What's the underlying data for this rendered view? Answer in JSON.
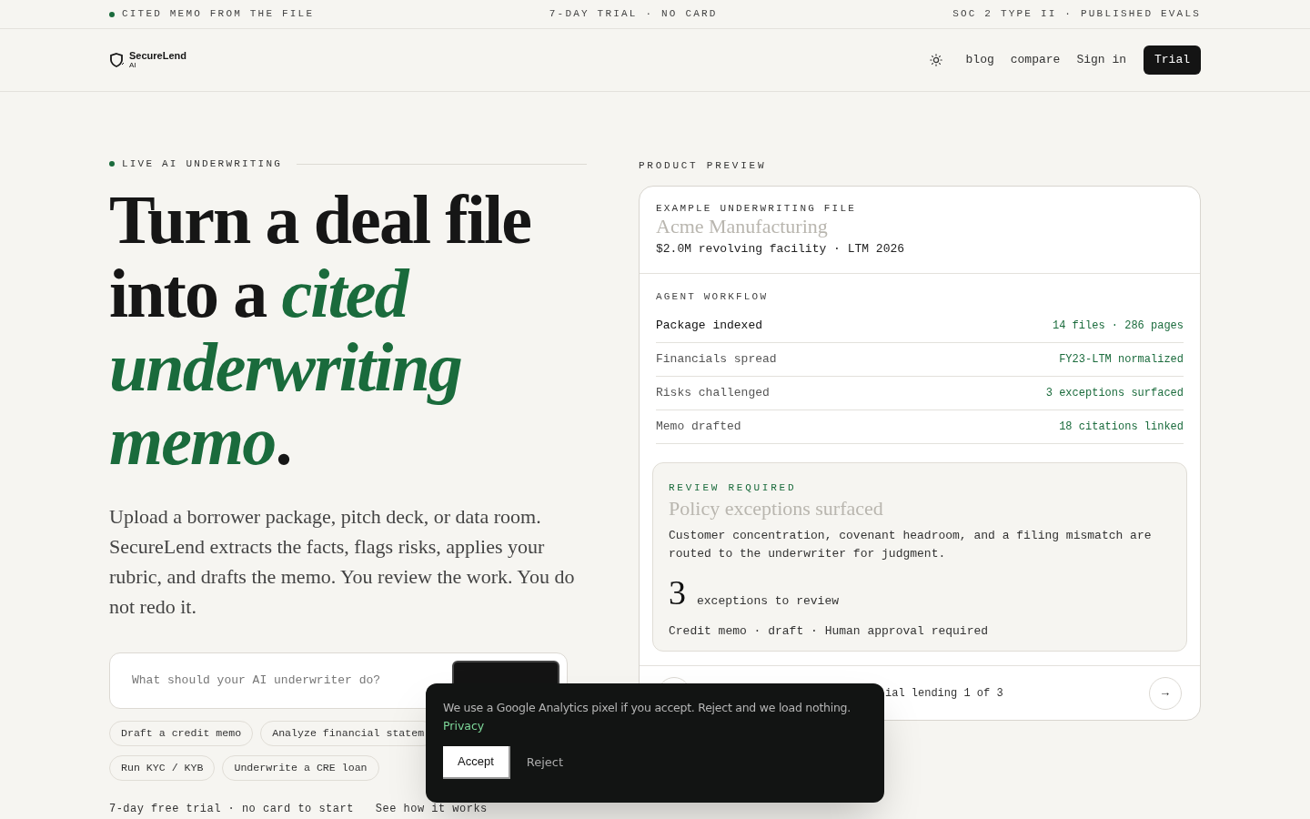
{
  "top_bar": {
    "left": "CITED MEMO FROM THE FILE",
    "center": "7-DAY TRIAL · NO CARD",
    "right": "SOC 2 TYPE II · PUBLISHED EVALS"
  },
  "nav": {
    "brand": "SecureLend",
    "brand_sub": "AI",
    "links": [
      "blog",
      "compare",
      "Sign in"
    ],
    "cta": "Trial"
  },
  "hero": {
    "eyebrow": "LIVE AI UNDERWRITING",
    "title_lines": [
      "Turn a deal file",
      "into a *cited*",
      "*underwriting*",
      "*memo*."
    ],
    "lede": "Upload a borrower package, pitch deck, or data room. SecureLend extracts the facts, flags risks, applies your rubric, and drafts the memo. You review the work. You do not redo it.",
    "prompt": {
      "placeholder": "What should your AI underwriter do?"
    },
    "chips": [
      "Draft a credit memo",
      "Analyze financial statem",
      "Run KYC / KYB",
      "Underwrite a CRE loan"
    ],
    "footnote": "7-day free trial · no card to start",
    "footnote_link": "See how it works"
  },
  "preview": {
    "label": "PRODUCT PREVIEW",
    "file_label": "EXAMPLE UNDERWRITING FILE",
    "file_title": "Acme Manufacturing",
    "file_meta": "$2.0M revolving facility · LTM 2026",
    "workflow_label": "AGENT WORKFLOW",
    "steps": [
      {
        "name": "Package indexed",
        "result": "14 files · 286 pages",
        "selected": true
      },
      {
        "name": "Financials spread",
        "result": "FY23-LTM normalized",
        "selected": false
      },
      {
        "name": "Risks challenged",
        "result": "3 exceptions surfaced",
        "selected": false
      },
      {
        "name": "Memo drafted",
        "result": "18 citations linked",
        "selected": false
      }
    ],
    "review": {
      "label": "REVIEW REQUIRED",
      "title": "Policy exceptions surfaced",
      "body": "Customer concentration, covenant headroom, and a filing mismatch are routed to the underwriter for judgment.",
      "count": "3",
      "count_label": "exceptions to review",
      "meta": "Credit memo · draft · Human approval required"
    },
    "footer": {
      "caption": "ial lending 1 of 3",
      "next": "→"
    }
  },
  "cookie": {
    "text": "We use a Google Analytics pixel if you accept. Reject and we load nothing.",
    "link": "Privacy",
    "accept": "Accept",
    "reject": "Reject"
  }
}
